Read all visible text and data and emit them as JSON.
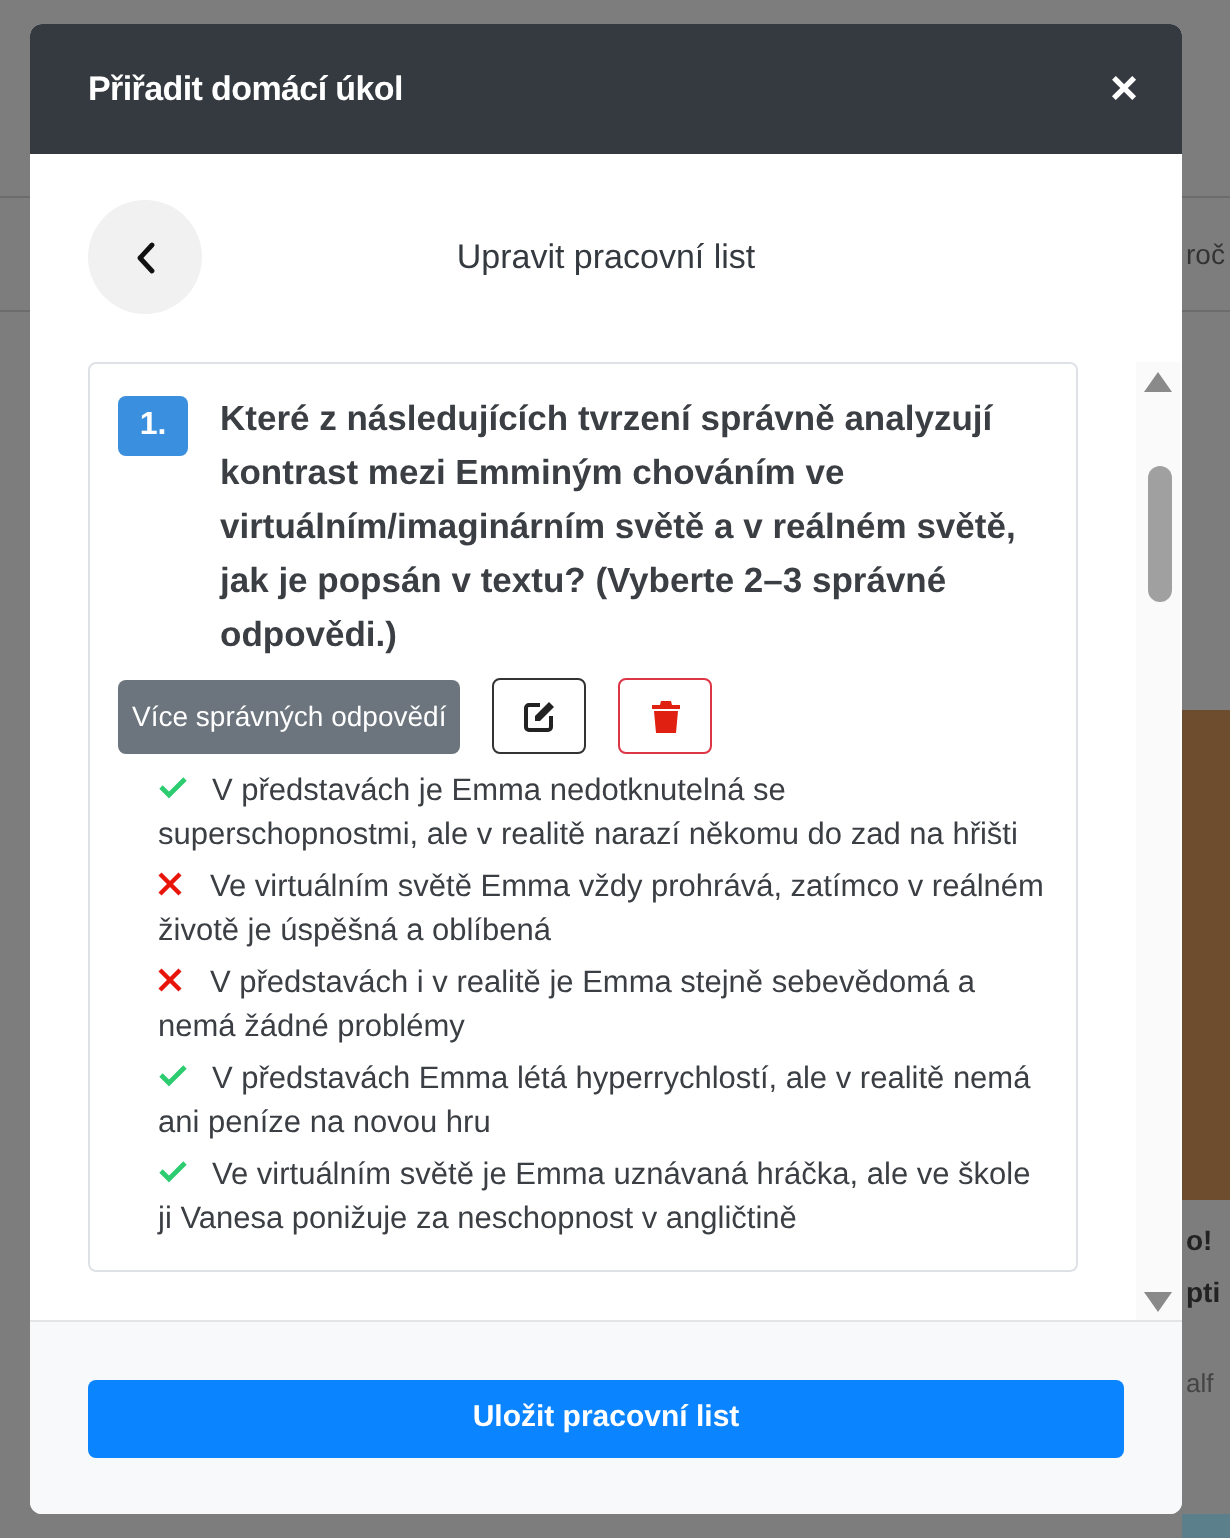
{
  "background": {
    "top_text": "roč",
    "card_title_lines": [
      "o!",
      "pti"
    ],
    "card_meta": "alf"
  },
  "modal": {
    "title": "Přiřadit domácí úkol",
    "close": "×"
  },
  "subheader": {
    "title": "Upravit pracovní list"
  },
  "questions": [
    {
      "number": "1.",
      "text": "Které z následujících tvrzení správně analyzují kontrast mezi Emminým chováním ve virtuálním/imaginárním světě a v reálném světě, jak je popsán v textu? (Vyberte 2–3 správné odpovědi.)",
      "type_badge": "Více správných odpovědí",
      "answers": [
        {
          "text": "V představách je Emma nedotknutelná se superschopnostmi, ale v realitě narazí někomu do zad na hřišti",
          "correct": true
        },
        {
          "text": "Ve virtuálním světě Emma vždy prohrává, zatímco v reálném životě je úspěšná a oblíbená",
          "correct": false
        },
        {
          "text": "V představách i v realitě je Emma stejně sebevědomá a nemá žádné problémy",
          "correct": false
        },
        {
          "text": "V představách Emma létá hyperrychlostí, ale v realitě nemá ani peníze na novou hru",
          "correct": true
        },
        {
          "text": "Ve virtuálním světě je Emma uznávaná hráčka, ale ve škole ji Vanesa ponižuje za neschopnost v angličtině",
          "correct": true
        }
      ]
    }
  ],
  "footer": {
    "save_button": "Uložit pracovní list"
  }
}
